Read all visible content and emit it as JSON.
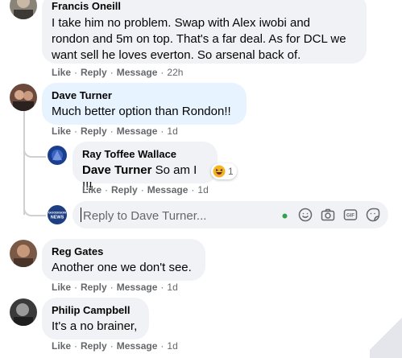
{
  "comments": [
    {
      "author": "Francis Oneill",
      "text_lines": [
        "I take him no problem. Swap with Alex iwobi and",
        "rondon and 5m on top. That's a far deal. As for DCL we",
        "want sell he loves everton. So arsenal back of."
      ],
      "actions": {
        "like": "Like",
        "reply": "Reply",
        "message": "Message",
        "time": "22h"
      }
    },
    {
      "author": "Dave Turner",
      "text": "Much better option than Rondon!!",
      "actions": {
        "like": "Like",
        "reply": "Reply",
        "message": "Message",
        "time": "1d"
      },
      "replies": [
        {
          "author": "Ray Toffee Wallace",
          "mention": "Dave Turner",
          "text": " So am I !!!",
          "reaction_count": "1",
          "reaction_icon": "haha-emoji-icon",
          "actions": {
            "like": "Like",
            "reply": "Reply",
            "message": "Message",
            "time": "1d"
          }
        }
      ]
    },
    {
      "author": "Reg Gates",
      "text": "Another one we don't see.",
      "actions": {
        "like": "Like",
        "reply": "Reply",
        "message": "Message",
        "time": "1d"
      }
    },
    {
      "author": "Philip Campbell",
      "text": "It's a no brainer,",
      "actions": {
        "like": "Like",
        "reply": "Reply",
        "message": "Message",
        "time": "1d"
      }
    }
  ],
  "reply_box": {
    "placeholder": "Reply to Dave Turner...",
    "avatar_text_top": "GOODISON",
    "avatar_text_bottom": "NEWS",
    "tools": [
      "emoji-icon",
      "camera-icon",
      "gif-icon",
      "sticker-icon"
    ]
  },
  "separator": "·",
  "colors": {
    "bubble": "#f0f2f5",
    "highlight": "#e7f3ff",
    "meta": "#65676b",
    "online": "#31a24c"
  }
}
